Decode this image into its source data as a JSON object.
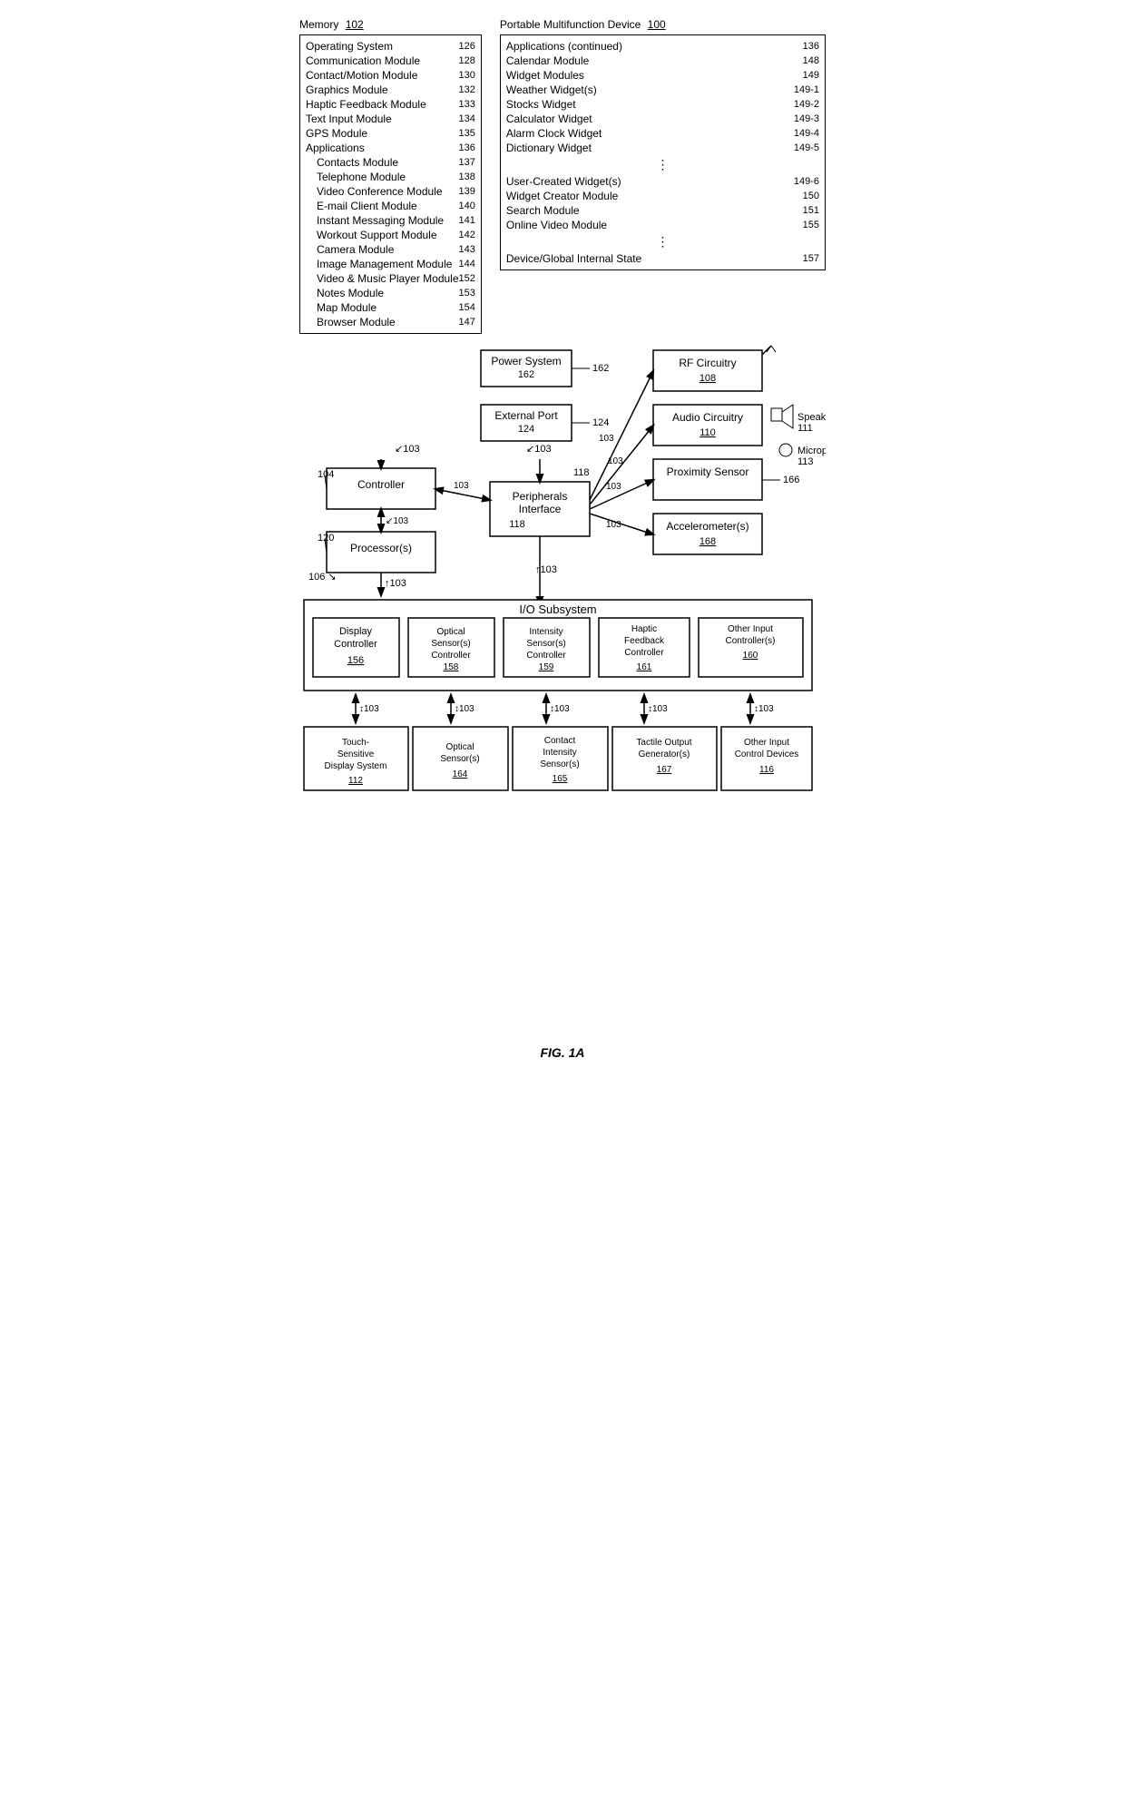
{
  "title": "FIG. 1A",
  "memory": {
    "label": "Memory",
    "ref": "102",
    "items": [
      {
        "text": "Operating System",
        "ref": "126",
        "indent": 0
      },
      {
        "text": "Communication Module",
        "ref": "128",
        "indent": 0
      },
      {
        "text": "Contact/Motion Module",
        "ref": "130",
        "indent": 0
      },
      {
        "text": "Graphics Module",
        "ref": "132",
        "indent": 0
      },
      {
        "text": "Haptic Feedback Module",
        "ref": "133",
        "indent": 0
      },
      {
        "text": "Text Input Module",
        "ref": "134",
        "indent": 0
      },
      {
        "text": "GPS Module",
        "ref": "135",
        "indent": 0
      },
      {
        "text": "Applications",
        "ref": "136",
        "indent": 0
      },
      {
        "text": "Contacts Module",
        "ref": "137",
        "indent": 1
      },
      {
        "text": "Telephone Module",
        "ref": "138",
        "indent": 1
      },
      {
        "text": "Video Conference Module",
        "ref": "139",
        "indent": 1
      },
      {
        "text": "E-mail Client Module",
        "ref": "140",
        "indent": 1
      },
      {
        "text": "Instant Messaging Module",
        "ref": "141",
        "indent": 1
      },
      {
        "text": "Workout Support Module",
        "ref": "142",
        "indent": 1
      },
      {
        "text": "Camera Module",
        "ref": "143",
        "indent": 1
      },
      {
        "text": "Image Management Module",
        "ref": "144",
        "indent": 1
      },
      {
        "text": "Video & Music Player Module",
        "ref": "152",
        "indent": 1
      },
      {
        "text": "Notes Module",
        "ref": "153",
        "indent": 1
      },
      {
        "text": "Map Module",
        "ref": "154",
        "indent": 1
      },
      {
        "text": "Browser Module",
        "ref": "147",
        "indent": 1
      }
    ]
  },
  "pmd": {
    "label": "Portable Multifunction Device",
    "ref": "100",
    "items": [
      {
        "text": "Applications (continued)",
        "ref": "136",
        "indent": 0
      },
      {
        "text": "Calendar Module",
        "ref": "148",
        "indent": 1
      },
      {
        "text": "Widget Modules",
        "ref": "149",
        "indent": 1
      },
      {
        "text": "Weather Widget(s)",
        "ref": "149-1",
        "indent": 2
      },
      {
        "text": "Stocks Widget",
        "ref": "149-2",
        "indent": 2
      },
      {
        "text": "Calculator Widget",
        "ref": "149-3",
        "indent": 2
      },
      {
        "text": "Alarm Clock Widget",
        "ref": "149-4",
        "indent": 2
      },
      {
        "text": "Dictionary Widget",
        "ref": "149-5",
        "indent": 2
      },
      {
        "text": "...",
        "ref": "",
        "indent": 2,
        "dots": true
      },
      {
        "text": "User-Created Widget(s)",
        "ref": "149-6",
        "indent": 2
      },
      {
        "text": "Widget Creator Module",
        "ref": "150",
        "indent": 1
      },
      {
        "text": "Search Module",
        "ref": "151",
        "indent": 1
      },
      {
        "text": "Online Video Module",
        "ref": "155",
        "indent": 1
      },
      {
        "text": "...",
        "ref": "",
        "indent": 1,
        "dots": true
      },
      {
        "text": "Device/Global Internal State",
        "ref": "157",
        "indent": 0
      }
    ]
  },
  "components": {
    "power_system": {
      "label": "Power System",
      "ref": "162"
    },
    "external_port": {
      "label": "External Port",
      "ref": "124"
    },
    "rf_circuitry": {
      "label": "RF Circuitry",
      "ref": "108"
    },
    "audio_circuitry": {
      "label": "Audio Circuitry",
      "ref": "110"
    },
    "proximity_sensor": {
      "label": "Proximity Sensor",
      "ref": "166"
    },
    "accelerometers": {
      "label": "Accelerometer(s)",
      "ref": "168"
    },
    "speaker": {
      "label": "Speaker",
      "ref": "111"
    },
    "microphone": {
      "label": "Microphone",
      "ref": "113"
    },
    "peripherals_interface": {
      "label": "Peripherals Interface",
      "ref": "118"
    },
    "controller": {
      "label": "Controller",
      "ref": "104"
    },
    "processor": {
      "label": "Processor(s)",
      "ref": "120"
    },
    "bus": {
      "label": "103"
    },
    "io_subsystem": {
      "label": "I/O Subsystem",
      "ref": "106"
    },
    "display_controller": {
      "label": "Display Controller",
      "ref": "156"
    },
    "optical_sensor_ctrl": {
      "label": "Optical Sensor(s) Controller",
      "ref": "158"
    },
    "intensity_sensor_ctrl": {
      "label": "Intensity Sensor(s) Controller",
      "ref": "159"
    },
    "haptic_feedback_ctrl": {
      "label": "Haptic Feedback Controller",
      "ref": "161"
    },
    "other_input_ctrl": {
      "label": "Other Input Controller(s)",
      "ref": "160"
    },
    "touch_display": {
      "label": "Touch-Sensitive Display System",
      "ref": "112"
    },
    "optical_sensors": {
      "label": "Optical Sensor(s)",
      "ref": "164"
    },
    "contact_intensity": {
      "label": "Contact Intensity Sensor(s)",
      "ref": "165"
    },
    "tactile_output": {
      "label": "Tactile Output Generator(s)",
      "ref": "167"
    },
    "other_input_devices": {
      "label": "Other Input Control Devices",
      "ref": "116"
    }
  }
}
